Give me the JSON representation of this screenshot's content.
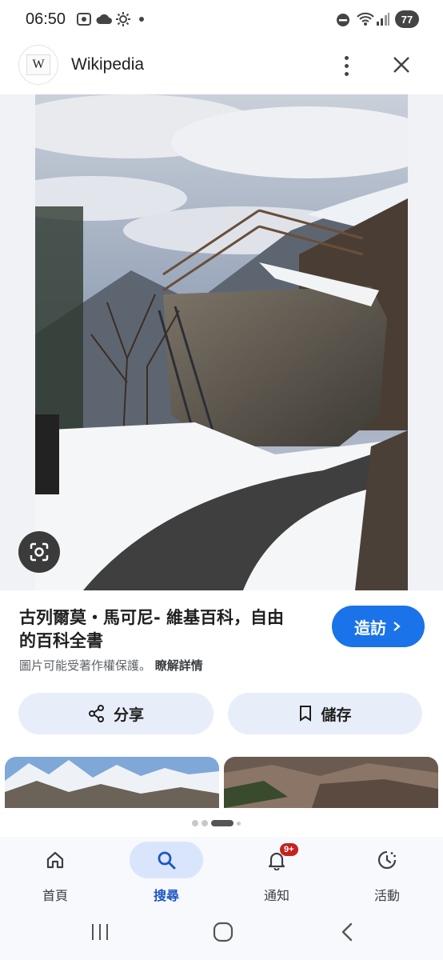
{
  "status_bar": {
    "time": "06:50",
    "battery": "77",
    "icons": [
      "screenshot-icon",
      "cloud-icon",
      "sun-icon",
      "dot-icon",
      "dnd-icon",
      "wifi-icon",
      "signal-icon"
    ]
  },
  "header": {
    "logo_letter": "W",
    "title": "Wikipedia",
    "icons": [
      "more-vert-icon",
      "close-icon"
    ]
  },
  "result": {
    "title": "古列爾莫・馬可尼- 維基百科，自由的百科全書",
    "title_line1": "古列爾莫・馬可尼- 維基百科，自由",
    "title_line2": "的百科全書",
    "visit_label": "造訪",
    "copyright_text": "圖片可能受著作權保護。",
    "learn_more": "瞭解詳情"
  },
  "actions": {
    "share_label": "分享",
    "save_label": "儲存"
  },
  "pager": {
    "count": 4,
    "active_index": 2
  },
  "bottom_nav": {
    "items": [
      {
        "label": "首頁",
        "icon": "home-icon",
        "active": false
      },
      {
        "label": "搜尋",
        "icon": "search-icon",
        "active": true
      },
      {
        "label": "通知",
        "icon": "bell-icon",
        "active": false,
        "badge": "9+"
      },
      {
        "label": "活動",
        "icon": "activity-icon",
        "active": false
      }
    ]
  },
  "system_nav": {
    "icons": [
      "recents-icon",
      "home-circle-icon",
      "back-icon"
    ]
  },
  "colors": {
    "accent": "#1a73e8",
    "chip_bg": "#e8eef9",
    "badge": "#c5221f"
  }
}
